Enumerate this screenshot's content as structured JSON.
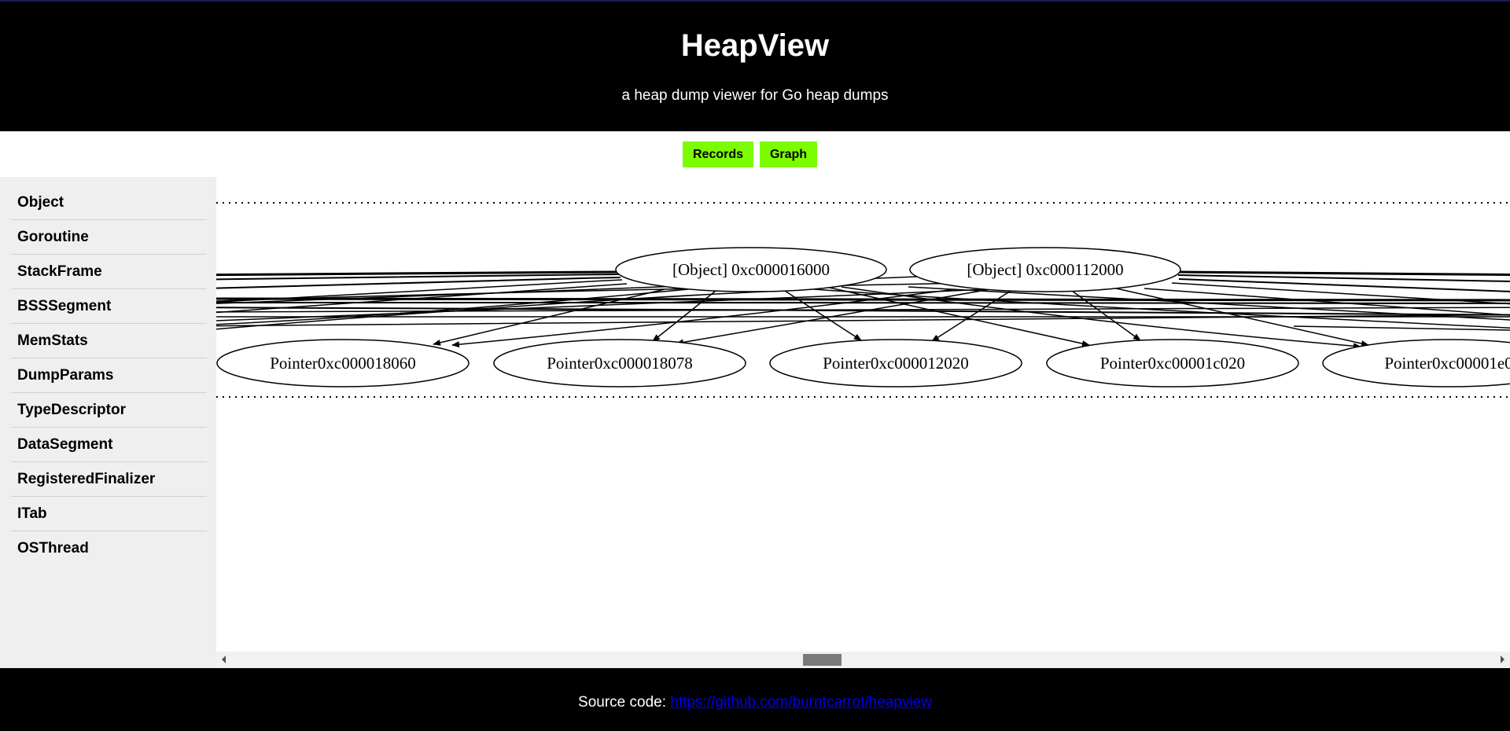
{
  "header": {
    "title": "HeapView",
    "subtitle": "a heap dump viewer for Go heap dumps"
  },
  "nav": {
    "buttons": [
      {
        "label": "Records"
      },
      {
        "label": "Graph"
      }
    ]
  },
  "sidebar": {
    "items": [
      {
        "label": "Object"
      },
      {
        "label": "Goroutine"
      },
      {
        "label": "StackFrame"
      },
      {
        "label": "BSSSegment"
      },
      {
        "label": "MemStats"
      },
      {
        "label": "DumpParams"
      },
      {
        "label": "TypeDescriptor"
      },
      {
        "label": "DataSegment"
      },
      {
        "label": "RegisteredFinalizer"
      },
      {
        "label": "ITab"
      },
      {
        "label": "OSThread"
      }
    ]
  },
  "graph": {
    "object_nodes": [
      {
        "label": "[Object] 0xc000016000"
      },
      {
        "label": "[Object] 0xc000112000"
      }
    ],
    "pointer_nodes": [
      {
        "label": "Pointer0xc000018060"
      },
      {
        "label": "Pointer0xc000018078"
      },
      {
        "label": "Pointer0xc000012020"
      },
      {
        "label": "Pointer0xc00001c020"
      },
      {
        "label": "Pointer0xc00001e0"
      }
    ]
  },
  "footer": {
    "prefix": "Source code: ",
    "link_text": "https://github.com/burntcarrot/heapview"
  },
  "colors": {
    "header_bg": "#000000",
    "button_bg": "#7cfc00",
    "sidebar_bg": "#efefef",
    "link": "#0000ee"
  }
}
